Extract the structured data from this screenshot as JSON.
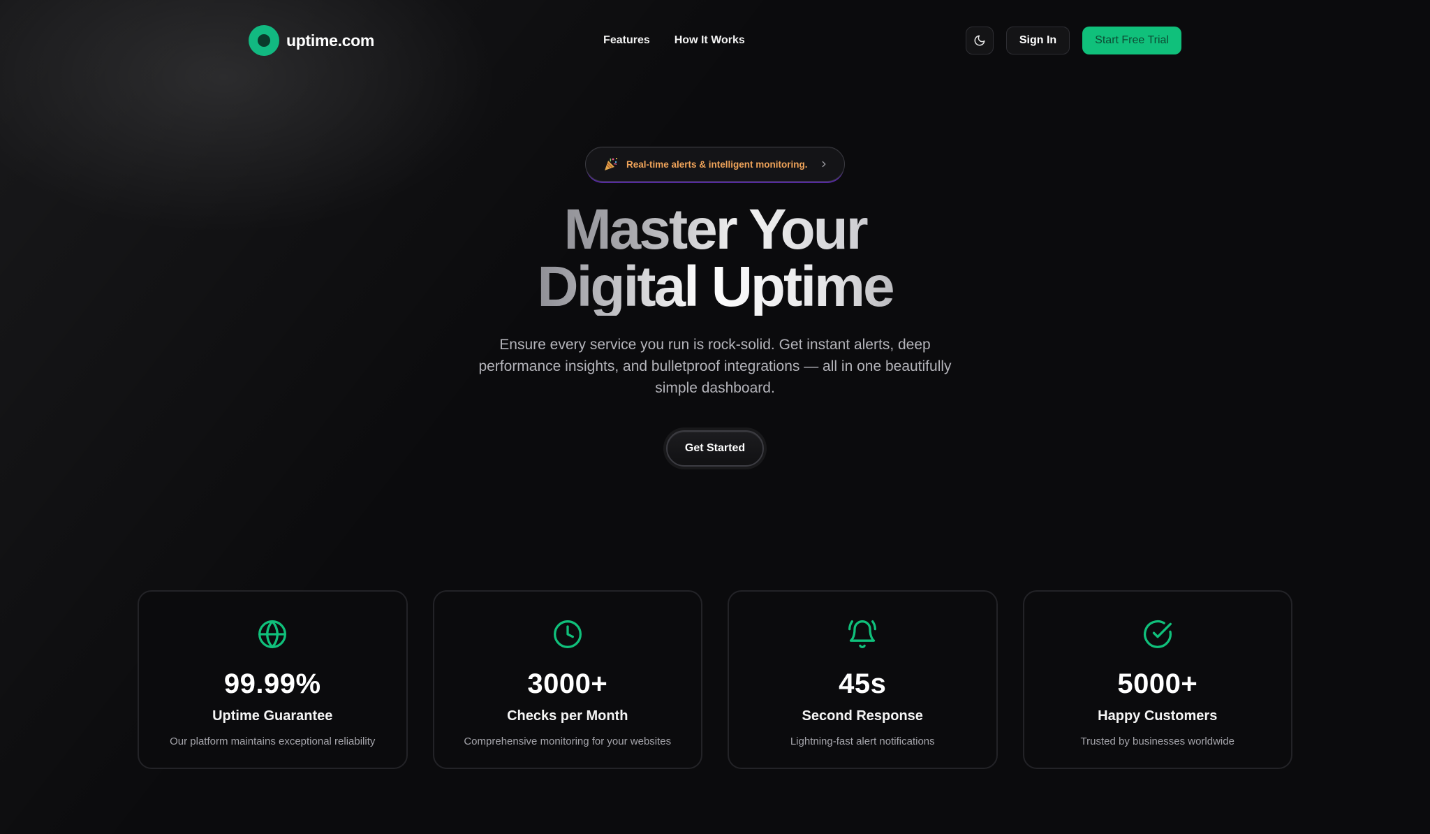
{
  "brand": {
    "name": "uptime.com",
    "accent": "#10c07b"
  },
  "nav": {
    "items": [
      {
        "label": "Features"
      },
      {
        "label": "How It Works"
      }
    ]
  },
  "actions": {
    "theme_toggle_icon": "moon-icon",
    "sign_in": "Sign In",
    "start_trial": "Start Free Trial"
  },
  "hero": {
    "announcement": "Real-time alerts & intelligent monitoring.",
    "headline_line1": "Master Your",
    "headline_line2": "Digital Uptime",
    "subtext": "Ensure every service you run is rock-solid. Get instant alerts, deep performance insights, and bulletproof integrations — all in one beautifully simple dashboard.",
    "cta": "Get Started"
  },
  "stats": [
    {
      "icon": "globe-icon",
      "value": "99.99%",
      "title": "Uptime Guarantee",
      "desc": "Our platform maintains exceptional reliability"
    },
    {
      "icon": "clock-icon",
      "value": "3000+",
      "title": "Checks per Month",
      "desc": "Comprehensive monitoring for your websites"
    },
    {
      "icon": "bell-ringing-icon",
      "value": "45s",
      "title": "Second Response",
      "desc": "Lightning-fast alert notifications"
    },
    {
      "icon": "check-circle-icon",
      "value": "5000+",
      "title": "Happy Customers",
      "desc": "Trusted by businesses worldwide"
    }
  ]
}
